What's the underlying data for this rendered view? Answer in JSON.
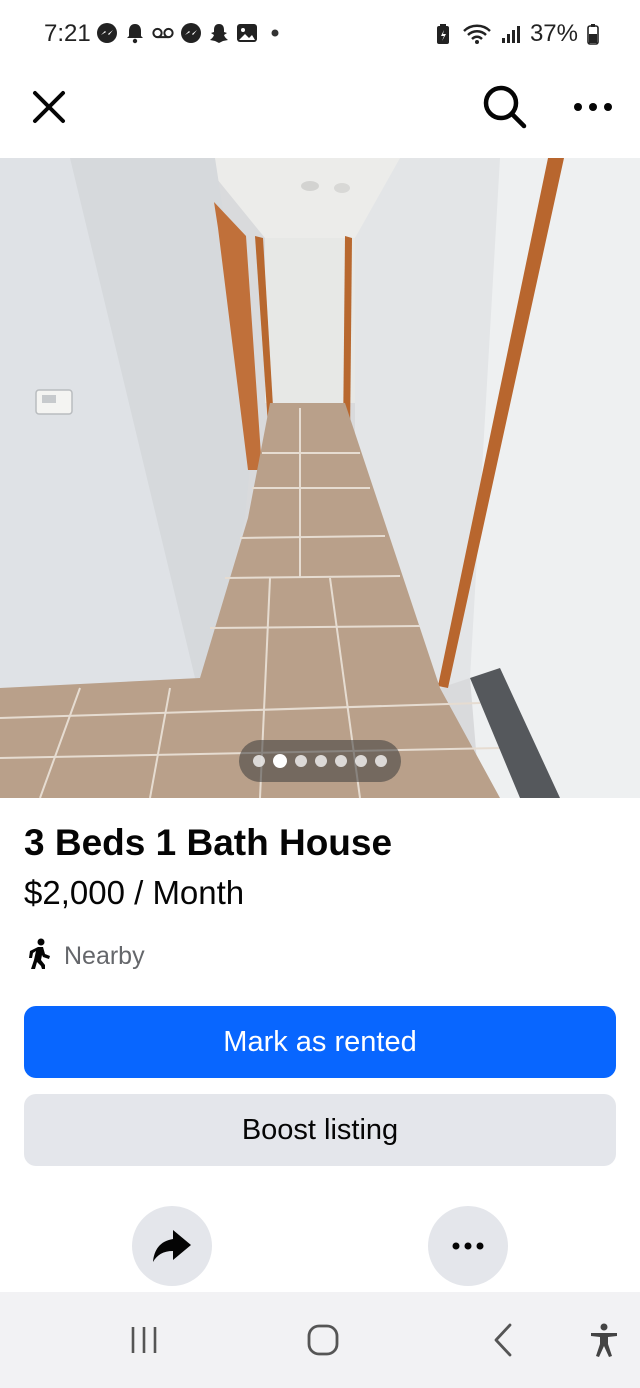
{
  "status_bar": {
    "time": "7:21",
    "battery": "37%",
    "left_icons": [
      "messenger-icon",
      "notification-bell-icon",
      "voicemail-icon",
      "messenger-icon",
      "snapchat-icon",
      "gallery-icon",
      "more-dot-icon"
    ],
    "right_icons": [
      "battery-saver-icon",
      "wifi-icon",
      "signal-icon",
      "battery-icon"
    ]
  },
  "top_bar": {
    "left_icon": "close-icon",
    "right_icons": [
      "search-icon",
      "more-icon"
    ]
  },
  "carousel": {
    "image_count": 7,
    "active_index": 1
  },
  "listing": {
    "title": "3 Beds 1 Bath House",
    "price": "$2,000 / Month",
    "location_icon": "walking-person-icon",
    "location": "Nearby"
  },
  "actions": {
    "primary": "Mark as rented",
    "secondary": "Boost listing",
    "share_icon": "share-arrow-icon",
    "options_icon": "more-horizontal-icon"
  },
  "nav_bar": {
    "items": [
      "recents-icon",
      "home-icon",
      "back-icon",
      "accessibility-icon"
    ]
  },
  "colors": {
    "primary": "#0866ff",
    "secondary_bg": "#e4e6eb",
    "text": "#050505",
    "muted": "#65676b"
  }
}
